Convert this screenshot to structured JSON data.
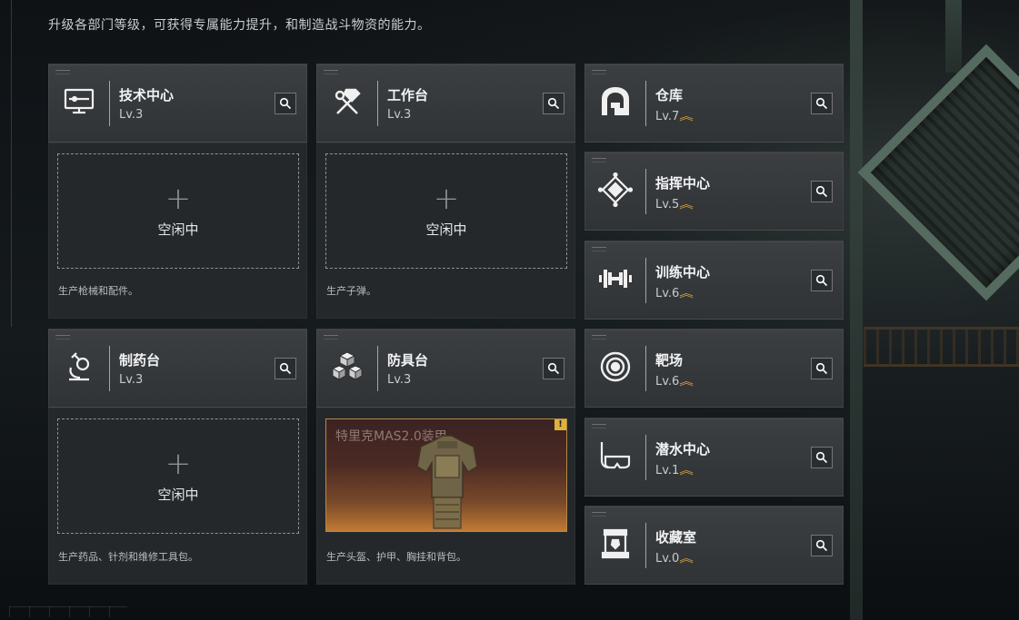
{
  "subtitle": "升级各部门等级，可获得专属能力提升，和制造战斗物资的能力。",
  "upgrade_glyph": "︽",
  "departments": [
    {
      "name": "技术中心",
      "level": "Lv.3",
      "icon": "computer-icon"
    },
    {
      "name": "工作台",
      "level": "Lv.3",
      "icon": "hammer-wrench-icon"
    },
    {
      "name": "仓库",
      "level": "Lv.7",
      "icon": "warehouse-icon",
      "upgradable": true
    },
    {
      "name": "指挥中心",
      "level": "Lv.5",
      "icon": "command-diamond-icon",
      "upgradable": true
    },
    {
      "name": "训练中心",
      "level": "Lv.6",
      "icon": "dumbbell-icon",
      "upgradable": true
    },
    {
      "name": "制药台",
      "level": "Lv.3",
      "icon": "microscope-icon"
    },
    {
      "name": "防具台",
      "level": "Lv.3",
      "icon": "armor-blocks-icon"
    },
    {
      "name": "靶场",
      "level": "Lv.6",
      "icon": "target-icon",
      "upgradable": true
    },
    {
      "name": "潜水中心",
      "level": "Lv.1",
      "icon": "diving-mask-icon",
      "upgradable": true
    },
    {
      "name": "收藏室",
      "level": "Lv.0",
      "icon": "display-case-icon",
      "upgradable": true
    }
  ],
  "production": [
    {
      "status": "空闲中",
      "plus": "+",
      "desc": "生产枪械和配件。"
    },
    {
      "status": "空闲中",
      "plus": "+",
      "desc": "生产子弹。"
    },
    {
      "status": "空闲中",
      "plus": "+",
      "desc": "生产药品、针剂和维修工具包。"
    },
    {
      "item_name": "特里克MAS2.0装甲",
      "badge": "!",
      "desc": "生产头盔、护甲、胸挂和背包。"
    }
  ],
  "colors": {
    "accent_gold": "#e0a43a",
    "card_bg": "#3c3f42",
    "panel_bg": "#25282b"
  }
}
